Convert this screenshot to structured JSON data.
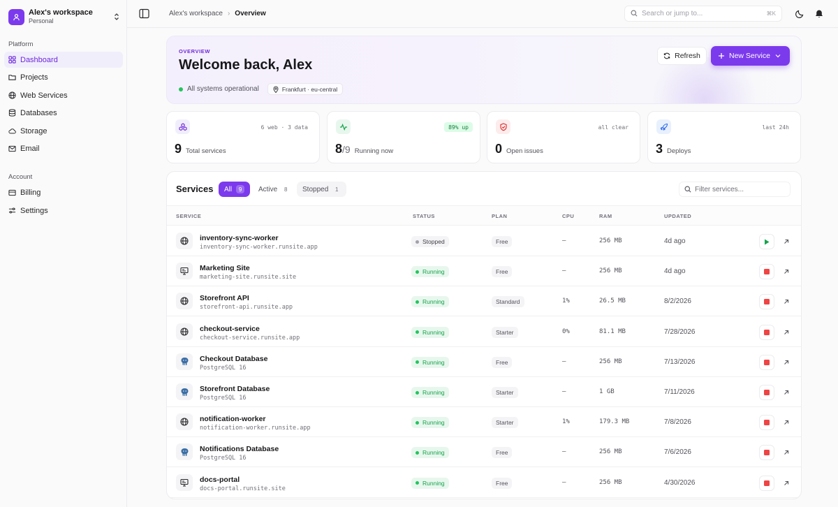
{
  "workspace": {
    "name": "Alex's workspace",
    "plan": "Personal"
  },
  "sidebar": {
    "platform_label": "Platform",
    "platform_items": [
      {
        "label": "Dashboard",
        "icon": "dashboard-icon",
        "active": true
      },
      {
        "label": "Projects",
        "icon": "folder-icon"
      },
      {
        "label": "Web Services",
        "icon": "globe-icon"
      },
      {
        "label": "Databases",
        "icon": "database-icon"
      },
      {
        "label": "Storage",
        "icon": "cloud-icon"
      },
      {
        "label": "Email",
        "icon": "mail-icon"
      }
    ],
    "account_label": "Account",
    "account_items": [
      {
        "label": "Billing",
        "icon": "credit-card-icon"
      },
      {
        "label": "Settings",
        "icon": "sliders-icon"
      }
    ]
  },
  "topbar": {
    "breadcrumb": [
      "Alex's workspace",
      "Overview"
    ],
    "search_placeholder": "Search or jump to...",
    "search_shortcut": "⌘K"
  },
  "hero": {
    "eyebrow": "OVERVIEW",
    "title": "Welcome back, Alex",
    "status_text": "All systems operational",
    "region": "Frankfurt · eu-central",
    "refresh_label": "Refresh",
    "new_service_label": "New Service"
  },
  "stats": [
    {
      "value": "9",
      "fraction": "",
      "label": "Total services",
      "badge": "6 web · 3 data",
      "icon": "cubes-icon"
    },
    {
      "value": "8",
      "fraction": "/9",
      "label": "Running now",
      "badge": "89% up",
      "icon": "activity-icon"
    },
    {
      "value": "0",
      "fraction": "",
      "label": "Open issues",
      "badge": "all clear",
      "icon": "shield-icon"
    },
    {
      "value": "3",
      "fraction": "",
      "label": "Deploys",
      "badge": "last 24h",
      "icon": "rocket-icon"
    }
  ],
  "services": {
    "title": "Services",
    "tabs": [
      {
        "label": "All",
        "count": "9",
        "active": true
      },
      {
        "label": "Active",
        "count": "8"
      },
      {
        "label": "Stopped",
        "count": "1"
      }
    ],
    "filter_placeholder": "Filter services...",
    "columns": [
      "SERVICE",
      "STATUS",
      "PLAN",
      "CPU",
      "RAM",
      "UPDATED"
    ],
    "rows": [
      {
        "name": "inventory-sync-worker",
        "sub": "inventory-sync-worker.runsite.app",
        "type": "globe",
        "status": "Stopped",
        "plan": "Free",
        "cpu": "—",
        "ram": "256 MB",
        "updated": "4d ago"
      },
      {
        "name": "Marketing Site",
        "sub": "marketing-site.runsite.site",
        "type": "monitor",
        "status": "Running",
        "plan": "Free",
        "cpu": "—",
        "ram": "256 MB",
        "updated": "4d ago"
      },
      {
        "name": "Storefront API",
        "sub": "storefront-api.runsite.app",
        "type": "globe",
        "status": "Running",
        "plan": "Standard",
        "cpu": "1%",
        "ram": "26.5 MB",
        "updated": "8/2/2026"
      },
      {
        "name": "checkout-service",
        "sub": "checkout-service.runsite.app",
        "type": "globe",
        "status": "Running",
        "plan": "Starter",
        "cpu": "0%",
        "ram": "81.1 MB",
        "updated": "7/28/2026"
      },
      {
        "name": "Checkout Database",
        "sub": "PostgreSQL 16",
        "type": "postgres",
        "status": "Running",
        "plan": "Free",
        "cpu": "—",
        "ram": "256 MB",
        "updated": "7/13/2026"
      },
      {
        "name": "Storefront Database",
        "sub": "PostgreSQL 16",
        "type": "postgres",
        "status": "Running",
        "plan": "Starter",
        "cpu": "—",
        "ram": "1 GB",
        "updated": "7/11/2026"
      },
      {
        "name": "notification-worker",
        "sub": "notification-worker.runsite.app",
        "type": "globe",
        "status": "Running",
        "plan": "Starter",
        "cpu": "1%",
        "ram": "179.3 MB",
        "updated": "7/8/2026"
      },
      {
        "name": "Notifications Database",
        "sub": "PostgreSQL 16",
        "type": "postgres",
        "status": "Running",
        "plan": "Free",
        "cpu": "—",
        "ram": "256 MB",
        "updated": "7/6/2026"
      },
      {
        "name": "docs-portal",
        "sub": "docs-portal.runsite.site",
        "type": "monitor",
        "status": "Running",
        "plan": "Free",
        "cpu": "—",
        "ram": "256 MB",
        "updated": "4/30/2026"
      }
    ]
  },
  "colors": {
    "accent": "#7c3aed",
    "running": "#16a34a",
    "stopped": "#71717a",
    "stop_button": "#ef4444"
  }
}
